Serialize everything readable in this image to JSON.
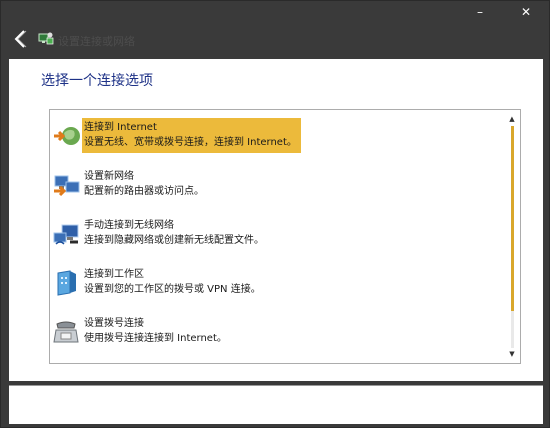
{
  "window": {
    "title": "设置连接或网络",
    "minimize_glyph": "–",
    "close_glyph": "✕"
  },
  "heading": "选择一个连接选项",
  "options": [
    {
      "title": "连接到 Internet",
      "desc": "设置无线、宽带或拨号连接，连接到 Internet。",
      "icon": "globe-icon",
      "selected": true
    },
    {
      "title": "设置新网络",
      "desc": "配置新的路由器或访问点。",
      "icon": "new-network-icon",
      "selected": false
    },
    {
      "title": "手动连接到无线网络",
      "desc": "连接到隐藏网络或创建新无线配置文件。",
      "icon": "wireless-network-icon",
      "selected": false
    },
    {
      "title": "连接到工作区",
      "desc": "设置到您的工作区的拨号或 VPN 连接。",
      "icon": "workplace-icon",
      "selected": false
    },
    {
      "title": "设置拨号连接",
      "desc": "使用拨号连接连接到 Internet。",
      "icon": "dialup-phone-icon",
      "selected": false
    }
  ],
  "scrollbar": {
    "up_glyph": "▲",
    "down_glyph": "▼",
    "position": 0
  },
  "colors": {
    "titlebar": "#3a3a3a",
    "heading": "#1e3287",
    "selection": "#ecba3b",
    "scroll_thumb": "#d9a72b"
  }
}
